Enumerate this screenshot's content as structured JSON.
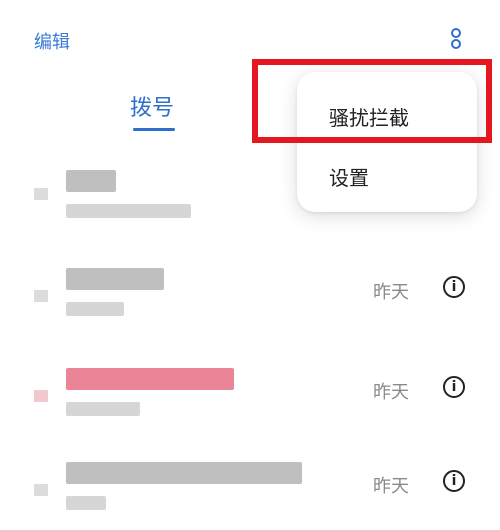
{
  "header": {
    "edit_label": "编辑",
    "more_icon": "more-vertical-icon"
  },
  "tabs": [
    {
      "label": "拨号",
      "active": true
    }
  ],
  "call_log": [
    {
      "name": "",
      "subtitle": "",
      "time": ""
    },
    {
      "name": "",
      "subtitle": "",
      "time": "昨天"
    },
    {
      "name": "",
      "subtitle": "",
      "time": "昨天",
      "missed": true
    },
    {
      "name": "",
      "subtitle": "",
      "time": "昨天"
    }
  ],
  "menu": {
    "items": [
      {
        "label": "骚扰拦截"
      },
      {
        "label": "设置"
      }
    ]
  },
  "colors": {
    "accent": "#2f6fcc",
    "missed": "#e8788c",
    "highlight": "#e4161f"
  }
}
